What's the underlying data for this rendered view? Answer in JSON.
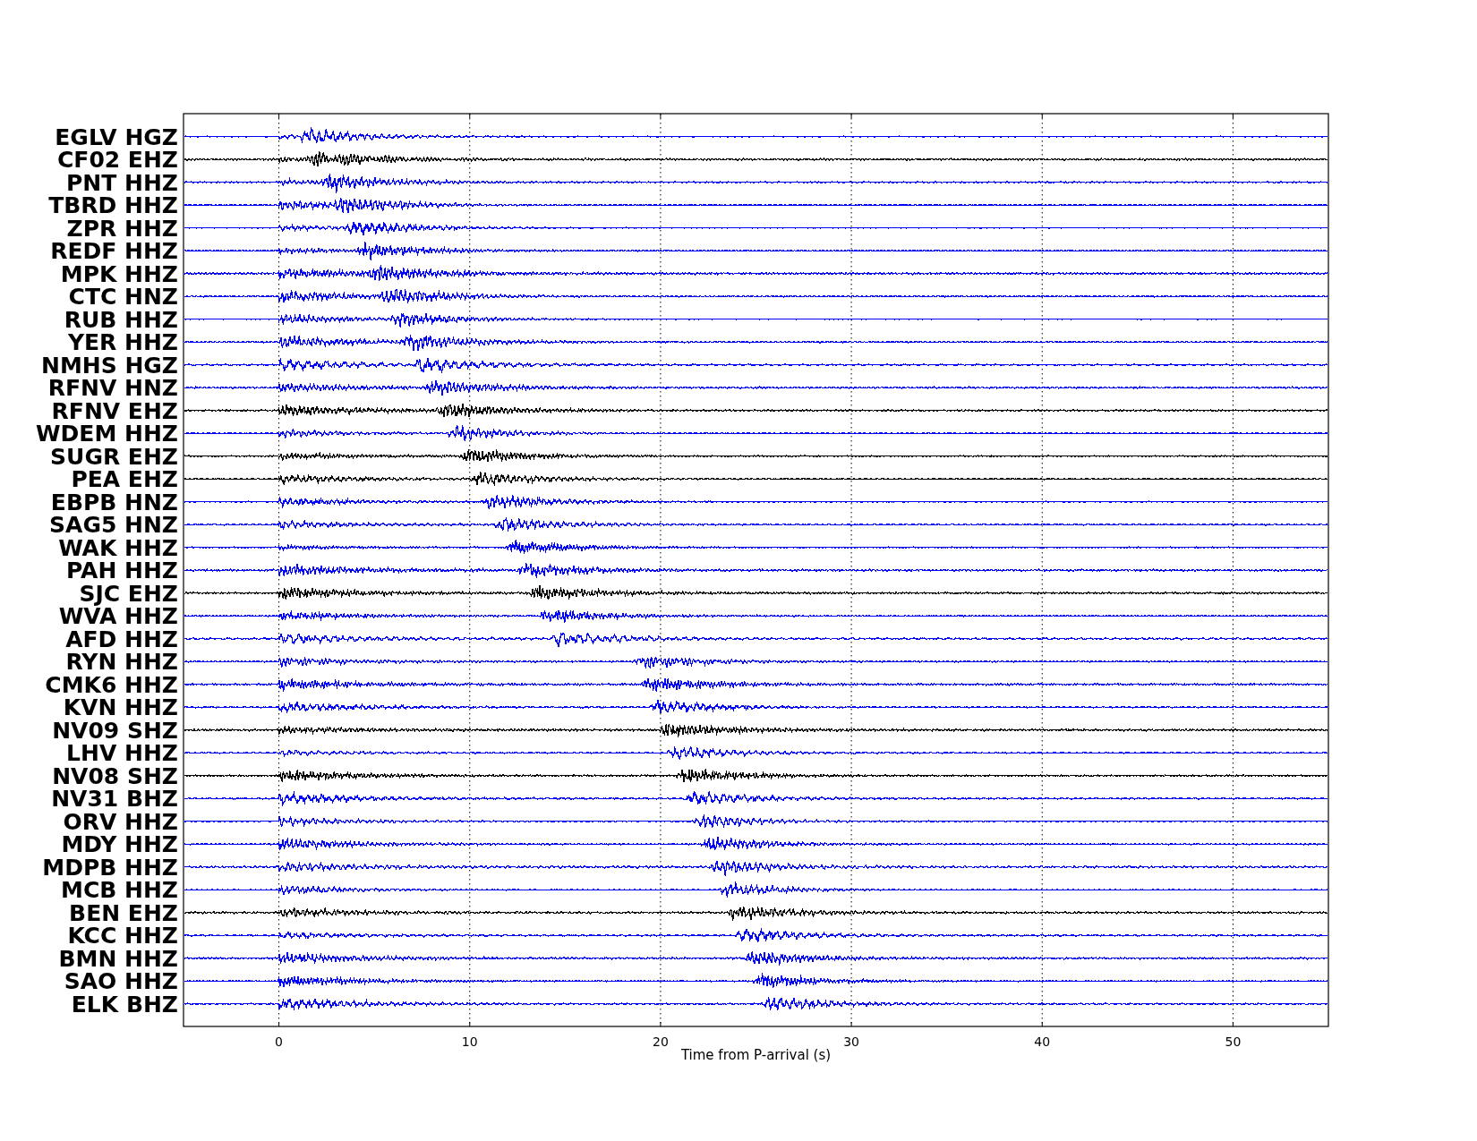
{
  "plot": {
    "xlabel": "Time from P-arrival (s)",
    "xticks": [
      "0",
      "10",
      "20",
      "30",
      "40",
      "50"
    ],
    "traces": [
      {
        "label": "EGLV HGZ",
        "color": "#0000ff"
      },
      {
        "label": "CF02 EHZ",
        "color": "#000000"
      },
      {
        "label": "PNT HHZ",
        "color": "#0000ff"
      },
      {
        "label": "TBRD HHZ",
        "color": "#0000ff"
      },
      {
        "label": "ZPR HHZ",
        "color": "#0000ff"
      },
      {
        "label": "REDF HHZ",
        "color": "#0000ff"
      },
      {
        "label": "MPK HHZ",
        "color": "#0000ff"
      },
      {
        "label": "CTC HNZ",
        "color": "#0000ff"
      },
      {
        "label": "RUB HHZ",
        "color": "#0000ff"
      },
      {
        "label": "YER HHZ",
        "color": "#0000ff"
      },
      {
        "label": "NMHS HGZ",
        "color": "#0000ff"
      },
      {
        "label": "RFNV HNZ",
        "color": "#0000ff"
      },
      {
        "label": "RFNV EHZ",
        "color": "#000000"
      },
      {
        "label": "WDEM HHZ",
        "color": "#0000ff"
      },
      {
        "label": "SUGR EHZ",
        "color": "#000000"
      },
      {
        "label": "PEA EHZ",
        "color": "#000000"
      },
      {
        "label": "EBPB HNZ",
        "color": "#0000ff"
      },
      {
        "label": "SAG5 HNZ",
        "color": "#0000ff"
      },
      {
        "label": "WAK HHZ",
        "color": "#0000ff"
      },
      {
        "label": "PAH HHZ",
        "color": "#0000ff"
      },
      {
        "label": "SJC EHZ",
        "color": "#000000"
      },
      {
        "label": "WVA HHZ",
        "color": "#0000ff"
      },
      {
        "label": "AFD HHZ",
        "color": "#0000ff"
      },
      {
        "label": "RYN HHZ",
        "color": "#0000ff"
      },
      {
        "label": "CMK6 HHZ",
        "color": "#0000ff"
      },
      {
        "label": "KVN HHZ",
        "color": "#0000ff"
      },
      {
        "label": "NV09 SHZ",
        "color": "#000000"
      },
      {
        "label": "LHV HHZ",
        "color": "#0000ff"
      },
      {
        "label": "NV08 SHZ",
        "color": "#000000"
      },
      {
        "label": "NV31 BHZ",
        "color": "#0000ff"
      },
      {
        "label": "ORV HHZ",
        "color": "#0000ff"
      },
      {
        "label": "MDY HHZ",
        "color": "#0000ff"
      },
      {
        "label": "MDPB HHZ",
        "color": "#0000ff"
      },
      {
        "label": "MCB HHZ",
        "color": "#0000ff"
      },
      {
        "label": "BEN EHZ",
        "color": "#000000"
      },
      {
        "label": "KCC HHZ",
        "color": "#0000ff"
      },
      {
        "label": "BMN HHZ",
        "color": "#0000ff"
      },
      {
        "label": "SAO HHZ",
        "color": "#0000ff"
      },
      {
        "label": "ELK BHZ",
        "color": "#0000ff"
      }
    ]
  }
}
